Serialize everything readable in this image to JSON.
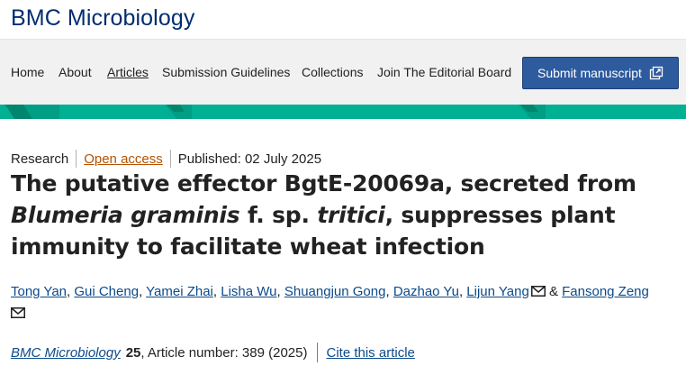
{
  "header": {
    "journal_title": "BMC Microbiology"
  },
  "nav": {
    "items": [
      "Home",
      "About",
      "Articles",
      "Submission Guidelines",
      "Collections",
      "Join The Editorial Board"
    ],
    "submit_label": "Submit manuscript",
    "icon": "external-link-icon"
  },
  "colors": {
    "brand_blue": "#002d6e",
    "button_blue": "#2e5a9e",
    "band_teal": "#00b093",
    "open_access_orange": "#b55200",
    "link_blue": "#0c4a8a"
  },
  "article": {
    "type": "Research",
    "access": "Open access",
    "published": "Published: 02 July 2025",
    "title_part1": "The putative effector BgtE-20069a, secreted from ",
    "title_species": "Blumeria graminis",
    "title_part2": " f. sp. ",
    "title_forma": "tritici",
    "title_part3": ", suppresses plant immunity to facilitate wheat infection",
    "authors": [
      "Tong Yan",
      "Gui Cheng",
      "Yamei Zhai",
      "Lisha Wu",
      "Shuangjun Gong",
      "Dazhao Yu",
      "Lijun Yang",
      "Fansong Zeng"
    ],
    "author_separator": ", ",
    "last_separator": " & ",
    "mail_icon": "envelope-icon"
  },
  "citation": {
    "journal": "BMC Microbiology",
    "volume": "25",
    "article_number": ", Article number: 389 (2025)",
    "cite_link": "Cite this article"
  }
}
